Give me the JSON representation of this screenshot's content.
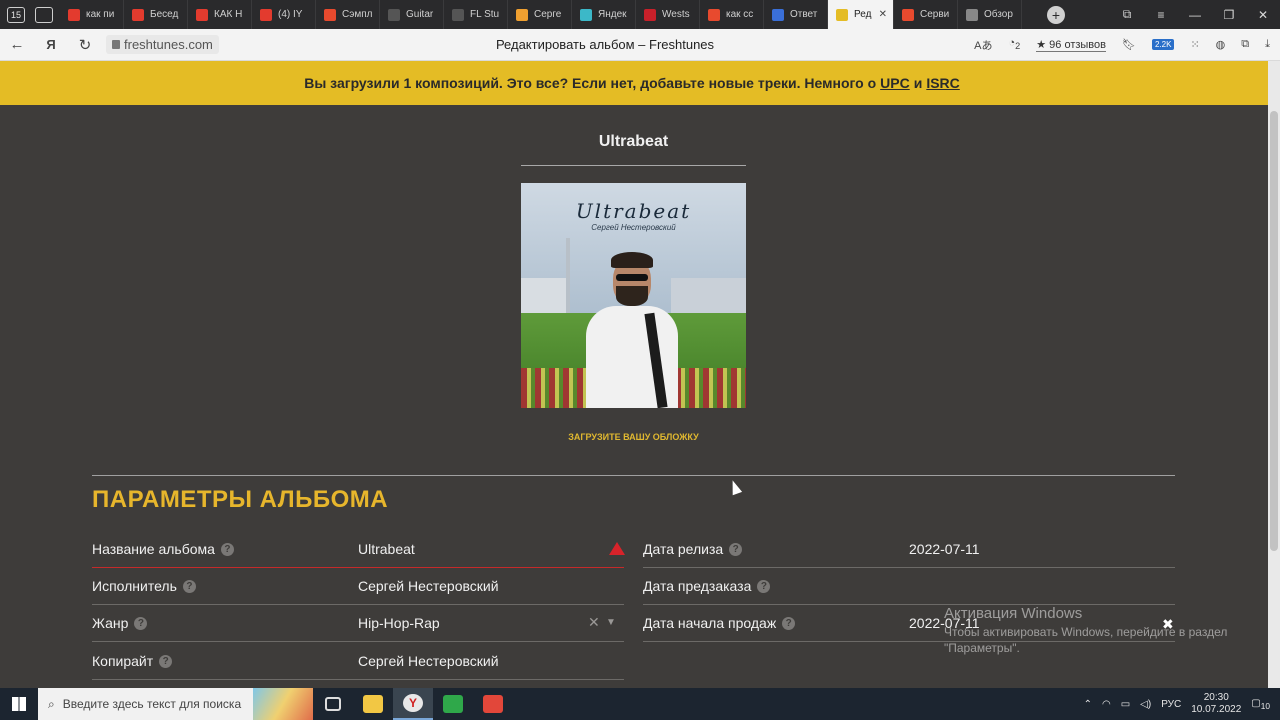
{
  "browser": {
    "tab_count_badge": "15",
    "tabs": [
      {
        "label": "как пи",
        "color": "#e33b2e"
      },
      {
        "label": "Бесед",
        "color": "#e33b2e"
      },
      {
        "label": "КАК Н",
        "color": "#e33b2e"
      },
      {
        "label": "(4) IY",
        "color": "#e33b2e"
      },
      {
        "label": "Сэмпл",
        "color": "#e84a2e"
      },
      {
        "label": "Guitar",
        "color": "#555555"
      },
      {
        "label": "FL Stu",
        "color": "#555555"
      },
      {
        "label": "Серге",
        "color": "#f0a030"
      },
      {
        "label": "Яндек",
        "color": "#3cb8c8"
      },
      {
        "label": "Wests",
        "color": "#c8202a"
      },
      {
        "label": "как сс",
        "color": "#e84a2e"
      },
      {
        "label": "Ответ",
        "color": "#3a6fd8"
      },
      {
        "label": "Ред",
        "color": "#e4bc25",
        "active": true
      },
      {
        "label": "Серви",
        "color": "#e84a2e"
      },
      {
        "label": "Обзор",
        "color": "#888888"
      }
    ],
    "url": "freshtunes.com",
    "page_title": "Редактировать альбом – Freshtunes",
    "reviews": "96 отзывов",
    "ext_badge": "2.2K",
    "ext_count": "2"
  },
  "banner": {
    "text": "Вы загрузили 1 композиций. Это все? Если нет, добавьте новые треки. Немного о",
    "link_upc": "UPC",
    "and": "и",
    "link_isrc": "ISRC"
  },
  "album": {
    "title": "Ultrabeat",
    "cover_title": "Ultrabeat",
    "cover_artist": "Сергей Нестеровский",
    "upload_cover": "ЗАГРУЗИТЕ ВАШУ ОБЛОЖКУ"
  },
  "params": {
    "section_title": "ПАРАМЕТРЫ АЛЬБОМА",
    "left": [
      {
        "label": "Название альбома",
        "value": "Ultrabeat"
      },
      {
        "label": "Исполнитель",
        "value": "Сергей Нестеровский"
      },
      {
        "label": "Жанр",
        "value": "Hip-Hop-Rap"
      },
      {
        "label": "Копирайт",
        "value": "Сергей Нестеровский"
      }
    ],
    "right": [
      {
        "label": "Дата релиза",
        "value": "2022-07-11"
      },
      {
        "label": "Дата предзаказа",
        "value": ""
      },
      {
        "label": "Дата начала продаж",
        "value": "2022-07-11"
      }
    ]
  },
  "windows_activation": {
    "title": "Активация Windows",
    "body": "Чтобы активировать Windows, перейдите в раздел \"Параметры\"."
  },
  "taskbar": {
    "search_placeholder": "Введите здесь текст для поиска",
    "lang": "РУС",
    "time": "20:30",
    "date": "10.07.2022",
    "notif_count": "10"
  }
}
